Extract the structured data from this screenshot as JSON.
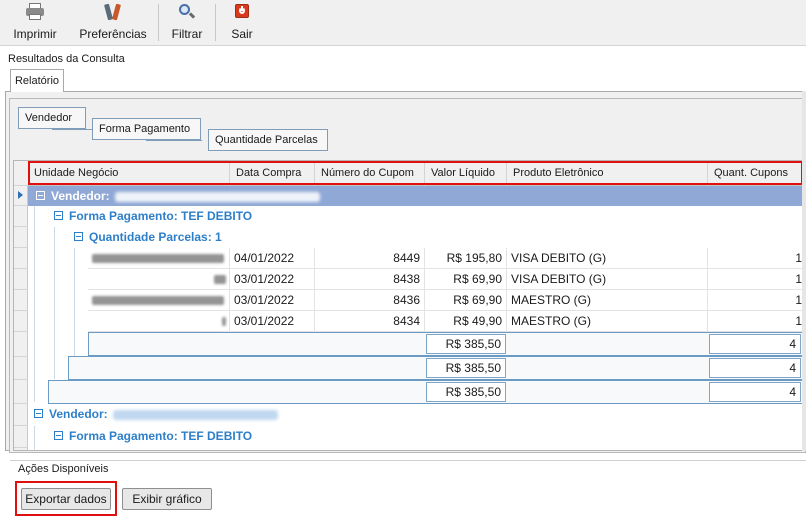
{
  "toolbar": {
    "print_label": "Imprimir",
    "prefs_label": "Preferências",
    "filter_label": "Filtrar",
    "exit_label": "Sair"
  },
  "results": {
    "title": "Resultados da Consulta",
    "tab_label": "Relatório"
  },
  "group_chips": {
    "vendedor": "Vendedor",
    "forma_pagamento": "Forma Pagamento",
    "quantidade_parcelas": "Quantidade Parcelas"
  },
  "columns": {
    "unidade": "Unidade Negócio",
    "data": "Data Compra",
    "cupom": "Número do Cupom",
    "valor": "Valor Líquido",
    "produto": "Produto Eletrônico",
    "quant": "Quant. Cupons"
  },
  "groups": {
    "vendedor1_label": "Vendedor:",
    "forma1_label": "Forma Pagamento: TEF DEBITO",
    "parcelas1_label": "Quantidade Parcelas: 1",
    "vendedor2_label": "Vendedor:",
    "forma2_label": "Forma Pagamento: TEF DEBITO"
  },
  "rows": [
    {
      "date": "04/01/2022",
      "cupom": "8449",
      "valor": "R$ 195,80",
      "produto": "VISA DEBITO (G)",
      "quant": "1"
    },
    {
      "date": "03/01/2022",
      "cupom": "8438",
      "valor": "R$ 69,90",
      "produto": "VISA DEBITO (G)",
      "quant": "1"
    },
    {
      "date": "03/01/2022",
      "cupom": "8436",
      "valor": "R$ 69,90",
      "produto": "MAESTRO (G)",
      "quant": "1"
    },
    {
      "date": "03/01/2022",
      "cupom": "8434",
      "valor": "R$ 49,90",
      "produto": "MAESTRO (G)",
      "quant": "1"
    }
  ],
  "summaries": {
    "parcelas_valor": "R$ 385,50",
    "parcelas_quant": "4",
    "forma_valor": "R$ 385,50",
    "forma_quant": "4",
    "vendedor_valor": "R$ 385,50",
    "vendedor_quant": "4"
  },
  "acoes": {
    "title": "Ações Disponíveis",
    "export_label": "Exportar dados",
    "chart_label": "Exibir gráfico"
  },
  "colors": {
    "group_header_bg": "#90a8d6",
    "group_text": "#2e7fc9",
    "highlight": "#e01010"
  }
}
